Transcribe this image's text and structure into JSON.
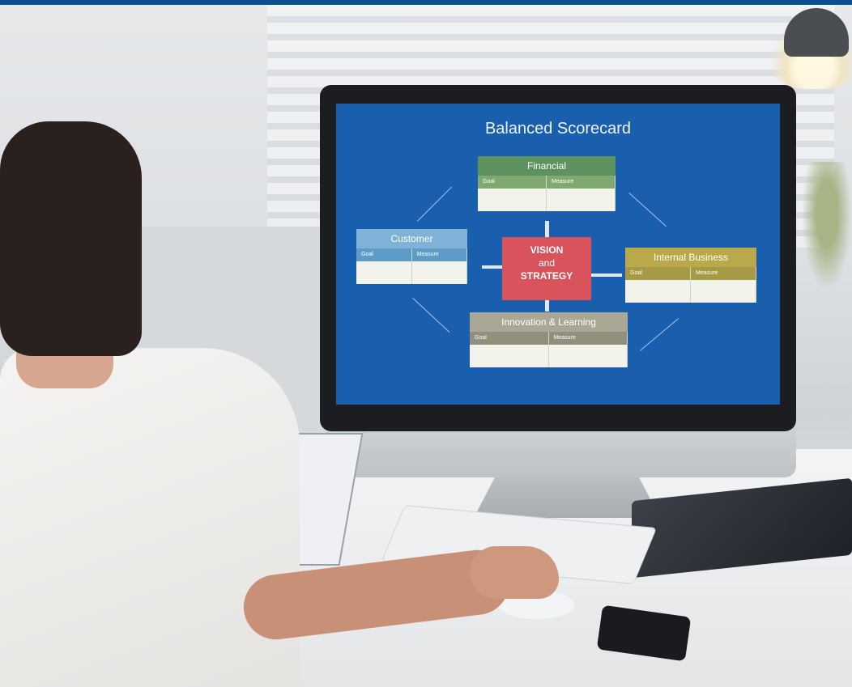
{
  "scene": {
    "monitor_content": {
      "title": "Balanced Scorecard",
      "center": {
        "line1": "VISION",
        "line2": "and",
        "line3": "STRATEGY"
      },
      "perspectives": [
        {
          "name": "Financial",
          "goal_label": "Goal",
          "measure_label": "Measure",
          "color": "#5d9160"
        },
        {
          "name": "Customer",
          "goal_label": "Goal",
          "measure_label": "Measure",
          "color": "#7fb2d6"
        },
        {
          "name": "Internal Business",
          "goal_label": "Goal",
          "measure_label": "Measure",
          "color": "#b9a94a"
        },
        {
          "name": "Innovation & Learning",
          "goal_label": "Goal",
          "measure_label": "Measure",
          "color": "#a9a796"
        }
      ],
      "colors": {
        "background": "#1a5fae",
        "center": "#d9535d"
      }
    }
  }
}
